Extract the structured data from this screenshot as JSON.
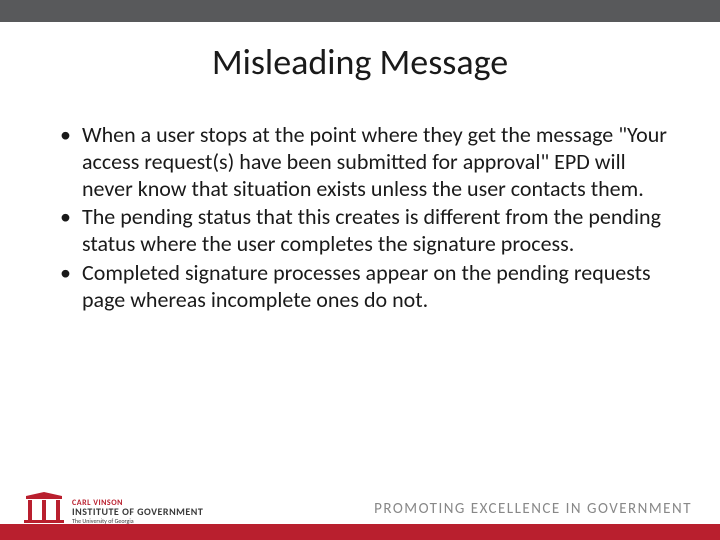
{
  "slide": {
    "title": "Misleading Message",
    "bullets": [
      "When a user stops at the point where they get the message \"Your access request(s) have been submitted for approval\" EPD will never know that situation exists unless the user contacts them.",
      "The pending status that this creates is different from the pending status where the user completes the signature process.",
      "Completed signature processes appear on the pending requests page whereas incomplete ones do not."
    ]
  },
  "footer": {
    "logo": {
      "line1": "CARL",
      "line2": "VINSON",
      "line3": "INSTITUTE OF GOVERNMENT",
      "line4": "The University of Georgia"
    },
    "tagline": "PROMOTING EXCELLENCE IN GOVERNMENT"
  }
}
